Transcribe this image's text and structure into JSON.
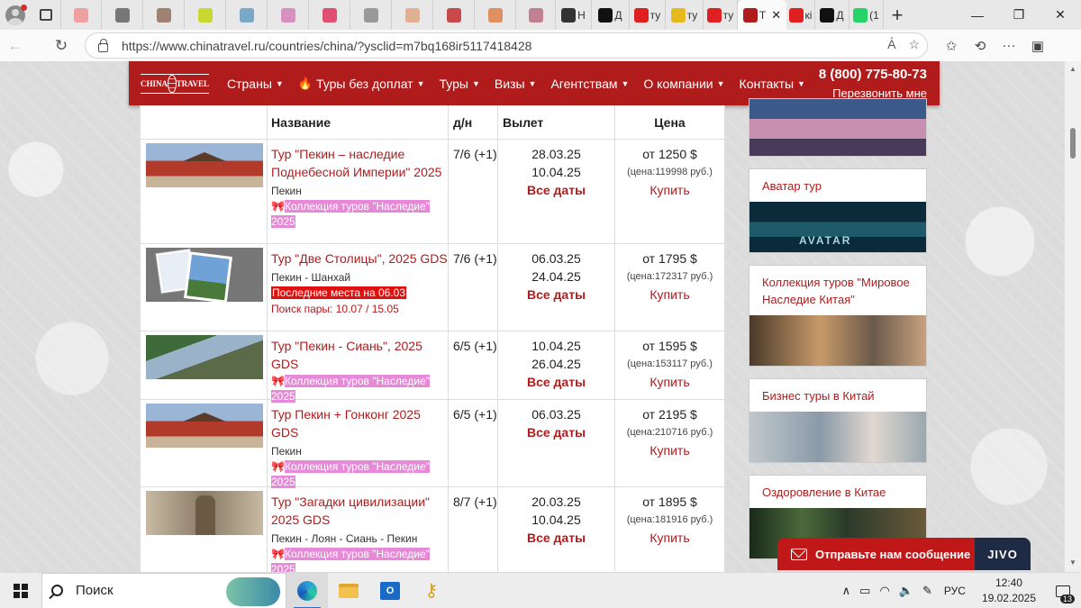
{
  "browser": {
    "tabs": [
      {
        "label": "",
        "icon": "yandex-icon",
        "color": "#f0a0a0"
      },
      {
        "label": "",
        "icon": "k-icon",
        "color": "#777777"
      },
      {
        "label": "",
        "icon": "a-icon",
        "color": "#a08070"
      },
      {
        "label": "",
        "icon": "kit-icon",
        "color": "#c8d830"
      },
      {
        "label": "",
        "icon": "chat-icon",
        "color": "#7aa8c8"
      },
      {
        "label": "",
        "icon": "pinwheel-icon",
        "color": "#d890c0"
      },
      {
        "label": "",
        "icon": "play-icon",
        "color": "#e05070"
      },
      {
        "label": "",
        "icon": "pause-icon",
        "color": "#999999"
      },
      {
        "label": "",
        "icon": "peach-icon",
        "color": "#e0b090"
      },
      {
        "label": "",
        "icon": "uk-flag-icon",
        "color": "#c84a4a"
      },
      {
        "label": "",
        "icon": "orange-circle-icon",
        "color": "#e09060"
      },
      {
        "label": "",
        "icon": "grid-icon",
        "color": "#c08090"
      },
      {
        "label": "Н",
        "icon": "calendar-icon",
        "color": "#333333"
      },
      {
        "label": "Д",
        "icon": "plus-icon",
        "color": "#111111"
      },
      {
        "label": "ту",
        "icon": "yandex-icon",
        "color": "#e02020"
      },
      {
        "label": "ту",
        "icon": "mountain-icon",
        "color": "#e8b820"
      },
      {
        "label": "ту",
        "icon": "yandex-icon",
        "color": "#e02020"
      },
      {
        "label": "Т",
        "icon": "china-travel-icon",
        "color": "#b01c1c",
        "active": true
      },
      {
        "label": "кі",
        "icon": "yandex-icon",
        "color": "#e02020"
      },
      {
        "label": "Д",
        "icon": "plus-icon",
        "color": "#111111"
      },
      {
        "label": "(1",
        "icon": "whatsapp-icon",
        "color": "#25d366"
      }
    ],
    "url": "https://www.chinatravel.ru/countries/china/?ysclid=m7bq168ir5117418428"
  },
  "site": {
    "logo_text": "CHINA TRAVEL",
    "menu": [
      {
        "label": "Страны",
        "has_flame": false
      },
      {
        "label": "Туры без доплат",
        "has_flame": true
      },
      {
        "label": "Туры",
        "has_flame": false
      },
      {
        "label": "Визы",
        "has_flame": false
      },
      {
        "label": "Агентствам",
        "has_flame": false
      },
      {
        "label": "О компании",
        "has_flame": false
      },
      {
        "label": "Контакты",
        "has_flame": false
      }
    ],
    "phone": "8 (800) 775-80-73",
    "callback": "Перезвонить мне"
  },
  "table": {
    "headers": {
      "name": "Название",
      "days": "д/н",
      "departure": "Вылет",
      "price": "Цена"
    },
    "all_dates_label": "Все даты",
    "buy_label": "Купить",
    "rows": [
      {
        "title": "Тур \"Пекин – наследие Поднебесной Империи\" 2025",
        "route": "Пекин",
        "collection": "Коллекция туров \"Наследие\" 2025",
        "hot": "",
        "pair": "",
        "days": "7/6 (+1)",
        "dates": [
          "28.03.25",
          "10.04.25"
        ],
        "price": "от 1250 $",
        "price_rub": "(цена:119998 руб.)",
        "image": "palace"
      },
      {
        "title": "Тур \"Две Столицы\", 2025 GDS",
        "route": "Пекин - Шанхай",
        "collection": "",
        "hot": "Последние места на 06.03",
        "pair": "Поиск пары: 10.07 / 15.05",
        "days": "7/6 (+1)",
        "dates": [
          "06.03.25",
          "24.04.25"
        ],
        "price": "от 1795 $",
        "price_rub": "(цена:172317 руб.)",
        "image": "photos"
      },
      {
        "title": "Тур \"Пекин - Сиань\", 2025 GDS",
        "route": "",
        "collection": "Коллекция туров \"Наследие\" 2025",
        "hot": "",
        "pair": "",
        "days": "6/5 (+1)",
        "dates": [
          "10.04.25",
          "26.04.25"
        ],
        "price": "от 1595 $",
        "price_rub": "(цена:153117 руб.)",
        "image": "garden"
      },
      {
        "title": "Тур Пекин + Гонконг 2025 GDS",
        "route": "Пекин",
        "collection": "Коллекция туров \"Наследие\" 2025",
        "hot": "",
        "pair": "",
        "days": "6/5 (+1)",
        "dates": [
          "06.03.25"
        ],
        "price": "от 2195 $",
        "price_rub": "(цена:210716 руб.)",
        "image": "palace"
      },
      {
        "title": "Тур \"Загадки цивилизации\" 2025 GDS",
        "route": "Пекин - Лоян - Сиань - Пекин",
        "collection": "Коллекция туров \"Наследие\" 2025",
        "hot": "",
        "pair": "",
        "days": "8/7 (+1)",
        "dates": [
          "20.03.25",
          "10.04.25"
        ],
        "price": "от 1895 $",
        "price_rub": "(цена:181916 руб.)",
        "image": "warrior"
      }
    ]
  },
  "sidebar": {
    "cards": [
      {
        "title": "",
        "image": "wall"
      },
      {
        "title": "Аватар тур",
        "image": "avatar",
        "image_text": "AVATAR"
      },
      {
        "title": "Коллекция туров \"Мировое Наследие Китая\"",
        "image": "heritage"
      },
      {
        "title": "Бизнес туры в Китай",
        "image": "business"
      },
      {
        "title": "Оздоровление в Китае",
        "image": "wellness"
      }
    ]
  },
  "chat": {
    "label": "Отправьте нам сообщение",
    "brand": "JIVO"
  },
  "taskbar": {
    "search_label": "Поиск",
    "lang": "РУС",
    "time": "12:40",
    "date": "19.02.2025",
    "notifications": "13"
  }
}
